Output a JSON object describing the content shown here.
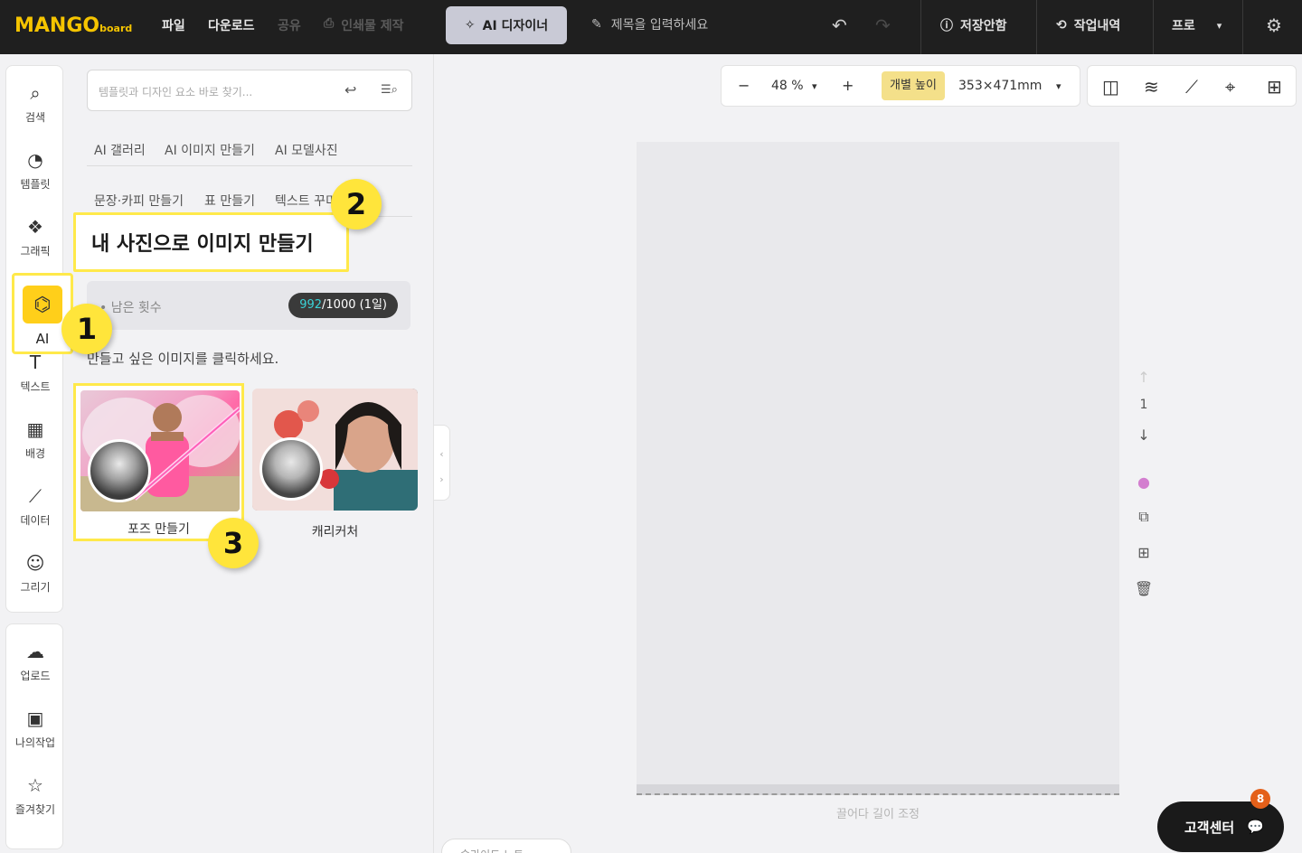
{
  "topbar": {
    "logo_main": "MANGO",
    "logo_sub": "board",
    "nav": [
      "파일",
      "다운로드",
      "공유",
      "인쇄물 제작"
    ],
    "ai_designer": "AI 디자이너",
    "title_placeholder": "제목을 입력하세요",
    "save_status": "저장안함",
    "history": "작업내역",
    "plan": "프로"
  },
  "rail": {
    "items": [
      "검색",
      "템플릿",
      "그래픽",
      "AI",
      "텍스트",
      "배경",
      "데이터",
      "그리기"
    ],
    "bottom_items": [
      "업로드",
      "나의작업",
      "즐겨찾기"
    ]
  },
  "panel": {
    "search_placeholder": "템플릿과 디자인 요소 바로 찾기...",
    "tabs_row1": [
      "AI 갤러리",
      "AI 이미지 만들기",
      "AI 모델사진"
    ],
    "tabs_row2": [
      "문장·카피 만들기",
      "표 만들기",
      "텍스트 꾸미"
    ],
    "callout_text": "내 사진으로 이미지 만들기",
    "remain_label": "남은 횟수",
    "remain_used": "992",
    "remain_total": "/1000 (1일)",
    "hint": "만들고 싶은 이미지를 클릭하세요.",
    "cards": [
      {
        "label": "포즈 만들기"
      },
      {
        "label": "캐리커처"
      }
    ]
  },
  "steps": [
    "1",
    "2",
    "3"
  ],
  "canvas": {
    "zoom": "48 %",
    "height_button": "개별 높이",
    "size": "353×471mm",
    "page_number": "1",
    "drag_hint": "끌어다 길이 조정"
  },
  "support": {
    "label": "고객센터",
    "badge": "8"
  },
  "bottom_pill": "슬라이드 노트"
}
